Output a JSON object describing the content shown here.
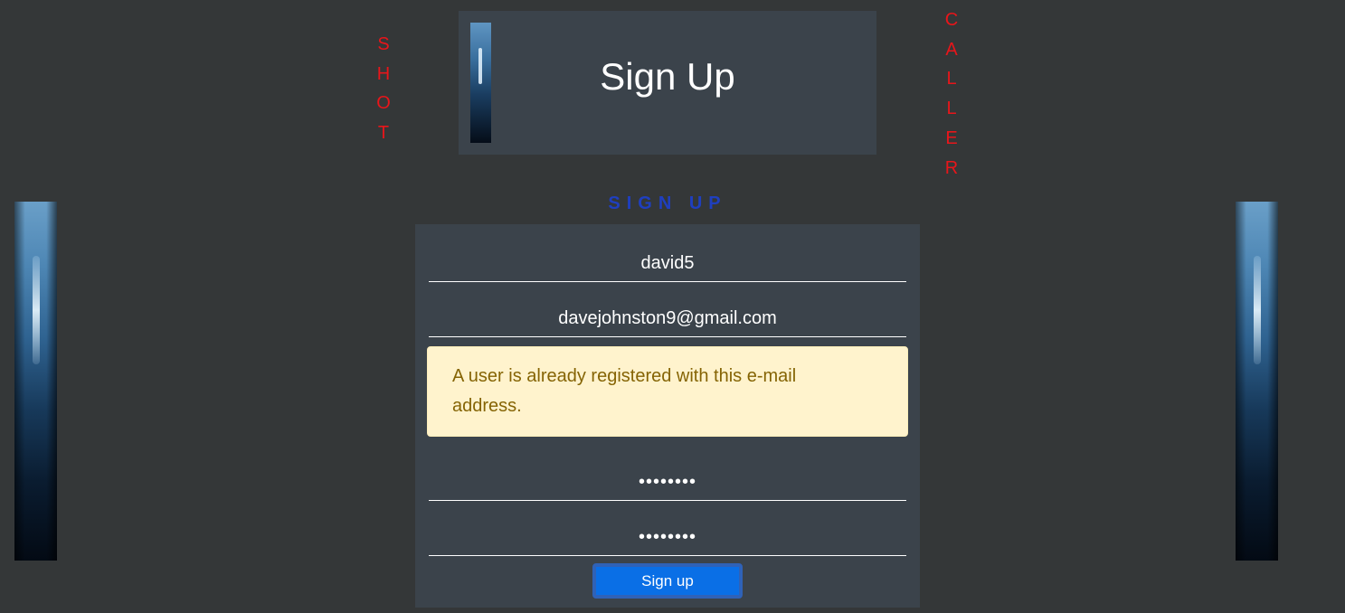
{
  "header": {
    "title": "Sign Up",
    "thumbnail_icon": "image-thumbnail"
  },
  "decorations": {
    "left_word": [
      "S",
      "H",
      "O",
      "T"
    ],
    "right_word": [
      "C",
      "A",
      "L",
      "L",
      "E",
      "R"
    ],
    "word_color": "#e8151a"
  },
  "form": {
    "heading": "SIGN UP",
    "username_value": "david5",
    "email_value": "davejohnston9@gmail.com",
    "password_value": "********",
    "password_confirm_value": "********",
    "alert_message": "A user is already registered with this e-mail address.",
    "submit_label": "Sign up"
  },
  "colors": {
    "background": "#343738",
    "card": "#3b434b",
    "heading_accent": "#1f3fbf",
    "button": "#0a6fe6",
    "alert_background": "#fff3cd",
    "alert_text": "#856404"
  }
}
